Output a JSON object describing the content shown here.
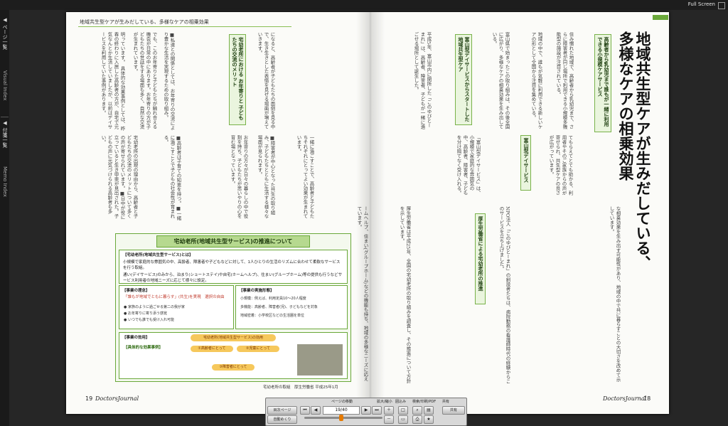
{
  "window": {
    "fullscreen": "Full Screen"
  },
  "side_tabs": [
    "◀ ページ一覧",
    "Visual Index",
    "◀ 付箋一覧",
    "Memo Index"
  ],
  "page_left": {
    "header": "地域共生型ケアが生みだしている、多様なケアの相乗効果",
    "col1": "明っています。 具体的な効果事例としては、昨春の終わりに入居した高齢者の方が、自宅で元気なんとか生活していましたが、以前はデイサービスを利用していた事例があります。",
    "col2": "でも、このお年寄りと子どもたちが触れ合える機会が日常の中にあります。お年寄りの方が子どもたちの世話をする場面も多く、自然な交流が生まれています。",
    "heading_a": "宅幼老所における お年寄りと 子どもたちの交流のメリット",
    "col3": "宅幼老所の出現の理由から、高齢者と子どもたちの交流のメリットについて多くの声が寄せられています。■日中が役に立っていると生き甲斐が見出された。子どもの声に元気づけられる高齢者も多い。",
    "col4": "■高齢者は子育ての知恵を持つ。■一緒に過ごすことで子どもの社会性が育まれる。",
    "col5": "■私達との関係としては、お年寄りの交流により豊かな生活を実現するための取り組み。",
    "col6": "になると、高齢者が子どもたちの面倒を見る中で、生き生きとした表情を見せる場面が増えていきます。",
    "col7": "■障害者が中心となった共生の取り組み、子どもたちとともに生活する様々な場面が見られます。",
    "col8": "お年寄りの方々が日々の暮らしの中で役割を持ち、子どもたちが思いやりの心を育む場となっています。",
    "col9": "一緒に過ごすことで、高齢者と子どもたちそれぞれにとってよい効果が生まれています。"
  },
  "diagram": {
    "title": "宅幼老所(地域共生型サービス)の推進について",
    "box1_label": "【宅幼老所(地域共生型サービス)とは】",
    "box1_line1": "小規模で家庭的な雰囲気の中、高齢者、障害者や子どもなどに対して、1人ひとりの生活のリズムに合わせて柔軟なサービスを行う取組。",
    "box1_line2": "通い(デイサービス)のみから、泊まり(ショートステイ)や自宅(ホームヘルプ)、住まい(グループホーム)等の提供も行うなどサービス利用者の地域ニーズに応じて様々に設定。",
    "philosophy_label": "【事業の理念】",
    "philosophy_text": "「誰もが地域でともに暮らす」(共生)を実現　選択の自由",
    "philosophy_items": [
      "● 家族のように過ごせる第二の我が家",
      "● お年寄りに寄り添う感覚",
      "● いつでも誰でも受け入れ可能"
    ],
    "scale_label": "【事業の実施形態】",
    "scale_items": [
      "小規模：例えば、利用定員10〜20人程度",
      "多機能：高齢者、障害者(児)、子どもなどを対象",
      "地域密着：小学校区などの生活圏を単位"
    ],
    "effect_label": "【事業の効用】",
    "effect_center": "宅幼老所(地域共生型サービス)の効用",
    "effect_elderly": "①高齢者にとって",
    "effect_children": "②児童にとって",
    "effect_disabled": "③障害者にとって",
    "examples_label": "【具体的な効果事例】",
    "caption": "宅幼老所の取組　厚生労働省 平成25年1月"
  },
  "page_right": {
    "title_lines": [
      "地域共生型ケアが生みだしている、",
      "多様なケアの相乗効果"
    ],
    "heading_1": "高齢者から乳幼児まで誰もが一緒に利用できる小規模ケアサービス",
    "col1": "住み慣れた地域で、高齢者から乳幼児まで、さらに障害者が同じ場所で利用できる小規模多機能型の施設が注目されている。",
    "col2": "富山県で始まったこの取り組みは、その後全国に広がり、多様なケアの相乗効果を生み出している。",
    "heading_2": "富山型デイサービスからスタートした地域共生型ケア",
    "col3": "平成5年、富山市内に開所した「このゆびとーまれ」は、高齢者、障害者、子どもが一緒に過ごせる場所として誕生した。",
    "col4": "地域の中で、誰もが気軽に利用できる新しいケアの形として全国から注目を集めている。",
    "col5": "てもらえてとても助かる、利用者やそのご家族からの声が寄せられ、共生型ケアの良さが広がっています。",
    "heading_3": "富山型デイサービス",
    "col6": "「富山型デイサービス」は、小規模で家庭的な雰囲気の中、高齢者、障害者、子どもを分け隔てなく受け入れる。",
    "col7": "NPO法人「このゆびとーまれ」の創設者たちは、病院勤務の看護師時代の経験からこのサービスを立ち上げました。",
    "heading_4": "厚生労働省による宅幼老所の推進",
    "col8": "厚生労働省は平成25年、全国の宅幼老所の取り組みを調査し、その推進について方針を示しています。",
    "col9": "な相乗効果を生み出す可能性があり、地域の中で共に暮らすことの大切さを改めて示しています。",
    "col10": "ームヘルプ、住まい(グループホーム)などの機能も持ち、地域の多様なニーズに応えています。"
  },
  "page_numbers": {
    "left": "19",
    "left_mag": "DoctorsJournal",
    "right_mag": "DoctorsJournal",
    "right": "18"
  },
  "controls": {
    "page_move": "ページの移動",
    "zoom": "拡大/縮小",
    "fit": "囲込み",
    "search_print": "検索/印刷/PDF",
    "share": "共有",
    "page_value": "19/40",
    "list_button": "目次ページ",
    "auto_button": "自動めくり",
    "share_button": "共有",
    "progress_fraction": 0.47
  },
  "colors": {
    "accent_green": "#6aa83a",
    "control_orange": "#e57a00"
  }
}
